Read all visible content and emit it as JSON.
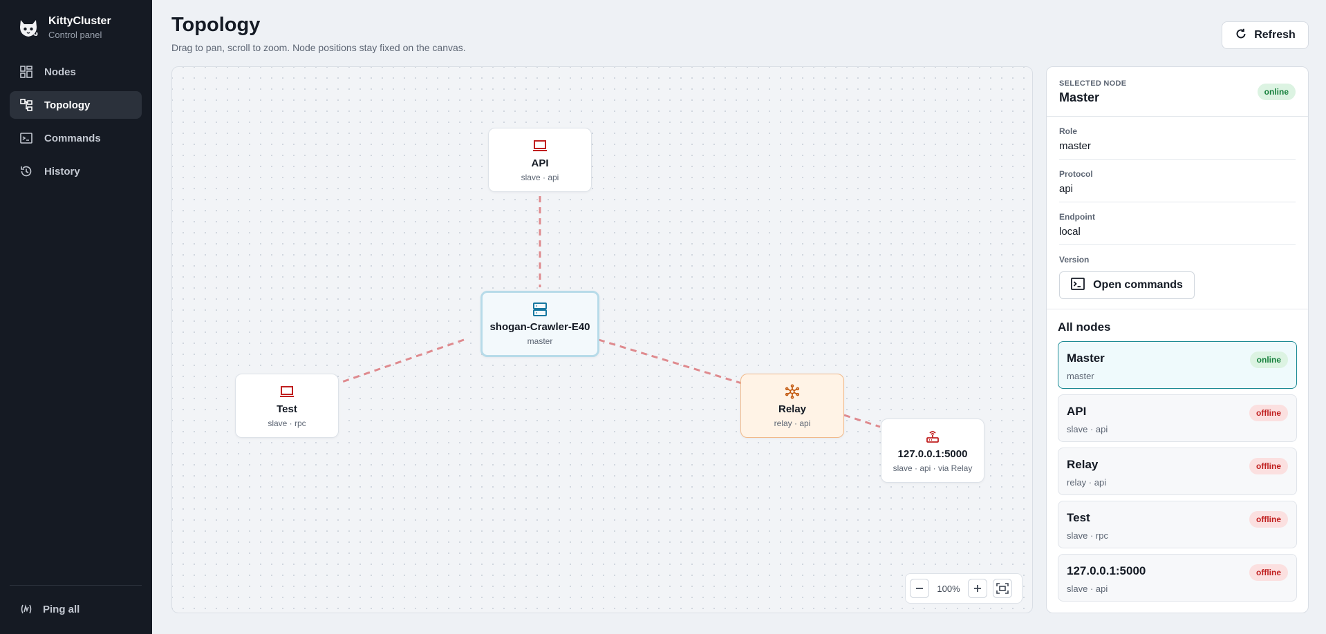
{
  "app": {
    "title": "KittyCluster",
    "subtitle": "Control panel"
  },
  "sidebar": {
    "items": [
      {
        "label": "Nodes",
        "icon": "grid-icon",
        "active": false
      },
      {
        "label": "Topology",
        "icon": "topology-icon",
        "active": true
      },
      {
        "label": "Commands",
        "icon": "terminal-icon",
        "active": false
      },
      {
        "label": "History",
        "icon": "history-icon",
        "active": false
      }
    ],
    "ping_label": "Ping all"
  },
  "header": {
    "title": "Topology",
    "subtitle": "Drag to pan, scroll to zoom. Node positions stay fixed on the canvas.",
    "refresh_label": "Refresh"
  },
  "topology": {
    "nodes": [
      {
        "name": "API",
        "meta": "slave · api",
        "icon": "laptop-icon"
      },
      {
        "name": "shogan-Crawler-E40",
        "meta": "master",
        "icon": "server-icon"
      },
      {
        "name": "Test",
        "meta": "slave · rpc",
        "icon": "laptop-icon"
      },
      {
        "name": "Relay",
        "meta": "relay · api",
        "icon": "hub-icon"
      },
      {
        "name": "127.0.0.1:5000",
        "meta": "slave · api · via Relay",
        "icon": "router-icon"
      }
    ],
    "zoom": "100%"
  },
  "selected": {
    "label": "SELECTED NODE",
    "name": "Master",
    "status": "online",
    "fields": [
      {
        "label": "Role",
        "value": "master"
      },
      {
        "label": "Protocol",
        "value": "api"
      },
      {
        "label": "Endpoint",
        "value": "local"
      },
      {
        "label": "Version",
        "value": ""
      }
    ],
    "open_commands_label": "Open commands"
  },
  "all_nodes": {
    "title": "All nodes",
    "items": [
      {
        "name": "Master",
        "meta": "master",
        "status": "online"
      },
      {
        "name": "API",
        "meta": "slave · api",
        "status": "offline"
      },
      {
        "name": "Relay",
        "meta": "relay · api",
        "status": "offline"
      },
      {
        "name": "Test",
        "meta": "slave · rpc",
        "status": "offline"
      },
      {
        "name": "127.0.0.1:5000",
        "meta": "slave · api",
        "status": "offline"
      }
    ]
  },
  "colors": {
    "sidebar_bg": "#151a23",
    "accent": "#1c8a94",
    "edge": "#df8a8e",
    "online": "#16803c",
    "offline": "#c01f1f",
    "relay_bg": "#fff3e6"
  }
}
